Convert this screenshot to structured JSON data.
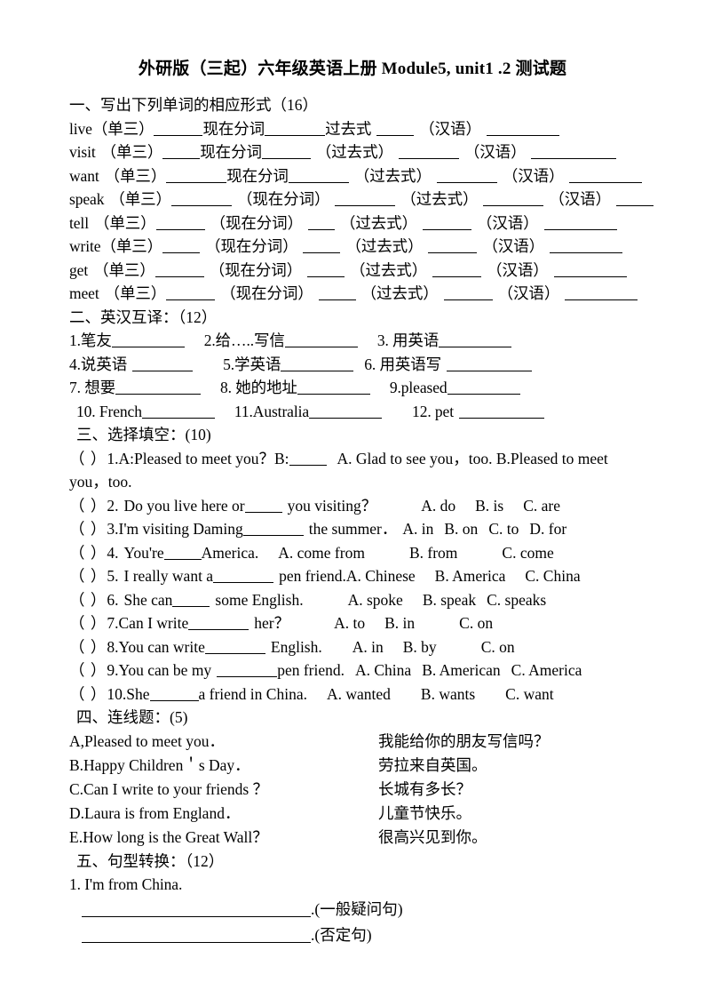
{
  "document": {
    "title": "外研版（三起）六年级英语上册 Module5, unit1 .2 测试题"
  },
  "section1": {
    "heading": "一、写出下列单词的相应形式（16）",
    "labels": {
      "third": "（单三）",
      "present_participle_plain": "现在分词",
      "present_participle_paren": "（现在分词）",
      "past_paren": "（过去式）",
      "past_plain": "过去式",
      "chinese": "（汉语）"
    },
    "words": [
      {
        "word": "live",
        "style": "a"
      },
      {
        "word": "visit",
        "style": "b"
      },
      {
        "word": "want",
        "style": "b"
      },
      {
        "word": "speak",
        "style": "c"
      },
      {
        "word": "tell",
        "style": "c"
      },
      {
        "word": "write",
        "style": "c"
      },
      {
        "word": "get",
        "style": "c"
      },
      {
        "word": "meet",
        "style": "c"
      }
    ]
  },
  "section2": {
    "heading": "二、英汉互译：（12）",
    "items": [
      "1.笔友",
      "2.给…..写信",
      "3. 用英语",
      "4.说英语",
      "5.学英语",
      "6. 用英语写",
      "7. 想要",
      "8. 她的地址",
      "9.pleased",
      "10. French",
      "11.Australia",
      "12. pet"
    ]
  },
  "section3": {
    "heading": "三、选择填空：(10)",
    "questions": [
      {
        "marker": "（   ）",
        "number": "1.",
        "stem_before": "A:Pleased to meet you？B:",
        "stem_after": "",
        "options": "A. Glad to see you，too. B.Pleased to meet",
        "continuation": "you，too."
      },
      {
        "marker": "（   ）",
        "number": "2.",
        "stem_before": "Do you live here or",
        "stem_after": "you visiting？",
        "options": [
          "A. do",
          "B. is",
          "C. are"
        ]
      },
      {
        "marker": "（   ）",
        "number": "3.",
        "stem_before": "I'm visiting Daming",
        "stem_after": "the summer．",
        "options": [
          "A. in",
          "B. on",
          "C. to",
          "D. for"
        ]
      },
      {
        "marker": "（   ）",
        "number": "4.",
        "stem_before": "You're",
        "stem_after": "America.",
        "options": [
          "A. come from",
          "B. from",
          "C. come"
        ]
      },
      {
        "marker": "（   ）",
        "number": "5.",
        "stem_before": "I really want a",
        "stem_after": "pen friend.",
        "options": [
          "A. Chinese",
          "B. America",
          "C. China"
        ]
      },
      {
        "marker": "（   ）",
        "number": "6.",
        "stem_before": "She can",
        "stem_after": "some English.",
        "options": [
          "A. spoke",
          "B. speak",
          "C. speaks"
        ]
      },
      {
        "marker": "（   ）",
        "number": "7.",
        "stem_before": "Can I write",
        "stem_after": "her？",
        "options": [
          "A. to",
          "B. in",
          "C. on"
        ]
      },
      {
        "marker": "（   ）",
        "number": "8.",
        "stem_before": "You can write",
        "stem_after": "English.",
        "options": [
          "A. in",
          "B. by",
          "C. on"
        ]
      },
      {
        "marker": "（   ）",
        "number": "9.",
        "stem_before": "You can be my",
        "stem_after": "pen friend.",
        "options": [
          "A. China",
          "B. American",
          "C. America"
        ]
      },
      {
        "marker": "（   ）",
        "number": "10.",
        "stem_before": "She",
        "stem_after": "a friend in China.",
        "options": [
          "A. wanted",
          "B. wants",
          "C. want"
        ]
      }
    ]
  },
  "section4": {
    "heading": "四、连线题：(5)",
    "pairs": [
      {
        "left": "A,Pleased to meet you．",
        "right": "我能给你的朋友写信吗？"
      },
      {
        "left": "B.Happy Children＇s Day．",
        "right": "劳拉来自英国。"
      },
      {
        "left": "C.Can I write to your friends ？",
        "right": "长城有多长？"
      },
      {
        "left": "D.Laura is from England．",
        "right": "儿童节快乐。"
      },
      {
        "left": "E.How long is the Great Wall？",
        "right": "很高兴见到你。"
      }
    ]
  },
  "section5": {
    "heading": "五、句型转换：（12）",
    "prompt": "1. I'm from China.",
    "answers": [
      ".(一般疑问句)",
      ".(否定句)"
    ]
  }
}
